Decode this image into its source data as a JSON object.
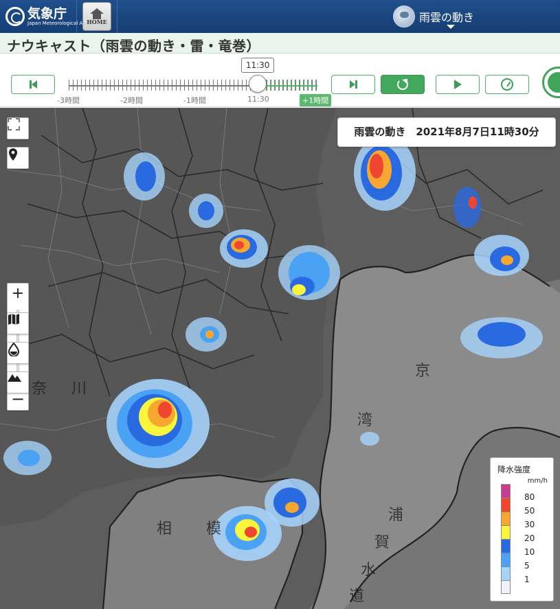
{
  "header": {
    "org_name_jp": "気象庁",
    "org_name_en": "Japan Meteorological Agency",
    "home_label": "HOME",
    "menu_label": "雨雲の動き"
  },
  "page": {
    "title": "ナウキャスト（雨雲の動き・雷・竜巻）"
  },
  "timeline": {
    "current_time": "11:30",
    "labels": [
      "-3時間",
      "-2時間",
      "-1時間",
      "11:30"
    ],
    "plus_label": "+1時間",
    "position": 0.76
  },
  "controls": {
    "buttons": [
      "skip-back",
      "skip-forward",
      "latest",
      "play",
      "speed"
    ]
  },
  "map": {
    "timestamp_label": "雨雲の動き　2021年8月7日11時30分",
    "zoom_level": 0.55
  },
  "legend": {
    "title": "降水強度",
    "unit": "mm/h",
    "items": [
      {
        "label": "80",
        "color": "#c93d8f"
      },
      {
        "label": "50",
        "color": "#f0452f"
      },
      {
        "label": "30",
        "color": "#f7a630"
      },
      {
        "label": "20",
        "color": "#f8f53c"
      },
      {
        "label": "10",
        "color": "#2a6ae0"
      },
      {
        "label": "5",
        "color": "#4aa2f5"
      },
      {
        "label": "1",
        "color": "#a6d3fb"
      },
      {
        "label": "",
        "color": "#f1f1fb"
      }
    ]
  },
  "colors": {
    "brand_blue": "#1f4f8c",
    "accent_green": "#42a85c"
  }
}
